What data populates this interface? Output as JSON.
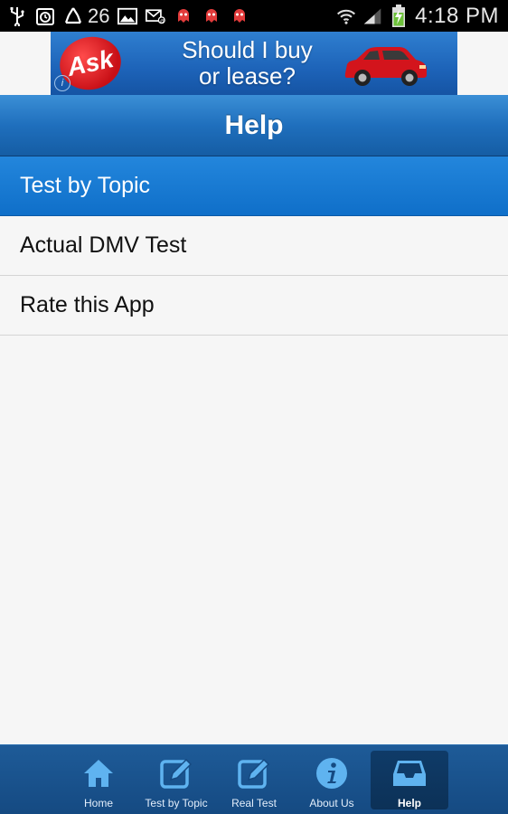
{
  "status_bar": {
    "notification_count": "26",
    "time": "4:18 PM"
  },
  "ad": {
    "brand": "Ask",
    "headline_line1": "Should I buy",
    "headline_line2": "or lease?"
  },
  "header": {
    "title": "Help"
  },
  "list": {
    "items": [
      {
        "label": "Test by Topic",
        "selected": true
      },
      {
        "label": "Actual DMV Test",
        "selected": false
      },
      {
        "label": "Rate this App",
        "selected": false
      }
    ]
  },
  "tabs": [
    {
      "label": "Home",
      "icon": "home-icon"
    },
    {
      "label": "Test by Topic",
      "icon": "edit-icon"
    },
    {
      "label": "Real Test",
      "icon": "edit-icon"
    },
    {
      "label": "About Us",
      "icon": "info-icon"
    },
    {
      "label": "Help",
      "icon": "inbox-icon",
      "active": true
    }
  ],
  "colors": {
    "header_blue": "#1f6fbd",
    "selected_blue": "#1479d1",
    "tabbar_blue": "#1a5590",
    "icon_blue": "#5fb3f0"
  }
}
